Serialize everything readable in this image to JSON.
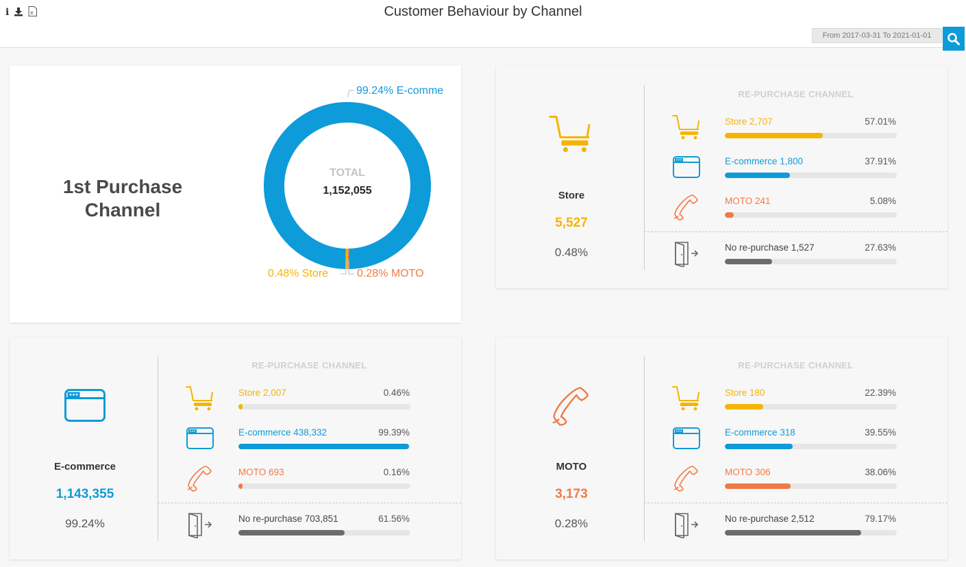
{
  "colors": {
    "store": "#f5b400",
    "ecom": "#0e9bd9",
    "moto": "#f07a45",
    "none": "#6b6b6b",
    "track": "#e6e6e6"
  },
  "toolbar": {
    "info_icon": "info-icon",
    "download_icon": "download-icon",
    "excel_icon": "excel-icon"
  },
  "header": {
    "title": "Customer Behaviour by Channel",
    "date_range": "From 2017-03-31 To 2021-01-01"
  },
  "first_purchase": {
    "title_line1": "1st Purchase",
    "title_line2": "Channel",
    "total_label": "TOTAL",
    "total_value": "1,152,055",
    "ecom_label": "99.24% E-comme",
    "store_label": "0.48% Store",
    "moto_label": "0.28% MOTO",
    "chart_data": {
      "type": "pie",
      "categories": [
        "E-commerce",
        "Store",
        "MOTO"
      ],
      "values": [
        99.24,
        0.48,
        0.28
      ]
    }
  },
  "section_head": "RE-PURCHASE CHANNEL",
  "cards": [
    {
      "id": "store",
      "name": "Store",
      "count": "5,527",
      "pct": "0.48%",
      "rows": [
        {
          "kind": "store",
          "label": "Store 2,707",
          "pct": "57.01%",
          "value": 57.01
        },
        {
          "kind": "ecom",
          "label": "E-commerce 1,800",
          "pct": "37.91%",
          "value": 37.91
        },
        {
          "kind": "moto",
          "label": "MOTO 241",
          "pct": "5.08%",
          "value": 5.08
        },
        {
          "kind": "none",
          "label": "No re-purchase 1,527",
          "pct": "27.63%",
          "value": 27.63
        }
      ]
    },
    {
      "id": "ecom",
      "name": "E-commerce",
      "count": "1,143,355",
      "pct": "99.24%",
      "rows": [
        {
          "kind": "store",
          "label": "Store 2,007",
          "pct": "0.46%",
          "value": 0.46
        },
        {
          "kind": "ecom",
          "label": "E-commerce 438,332",
          "pct": "99.39%",
          "value": 99.39
        },
        {
          "kind": "moto",
          "label": "MOTO 693",
          "pct": "0.16%",
          "value": 0.16
        },
        {
          "kind": "none",
          "label": "No re-purchase 703,851",
          "pct": "61.56%",
          "value": 61.56
        }
      ]
    },
    {
      "id": "moto",
      "name": "MOTO",
      "count": "3,173",
      "pct": "0.28%",
      "rows": [
        {
          "kind": "store",
          "label": "Store 180",
          "pct": "22.39%",
          "value": 22.39
        },
        {
          "kind": "ecom",
          "label": "E-commerce 318",
          "pct": "39.55%",
          "value": 39.55
        },
        {
          "kind": "moto",
          "label": "MOTO 306",
          "pct": "38.06%",
          "value": 38.06
        },
        {
          "kind": "none",
          "label": "No re-purchase 2,512",
          "pct": "79.17%",
          "value": 79.17
        }
      ]
    }
  ]
}
